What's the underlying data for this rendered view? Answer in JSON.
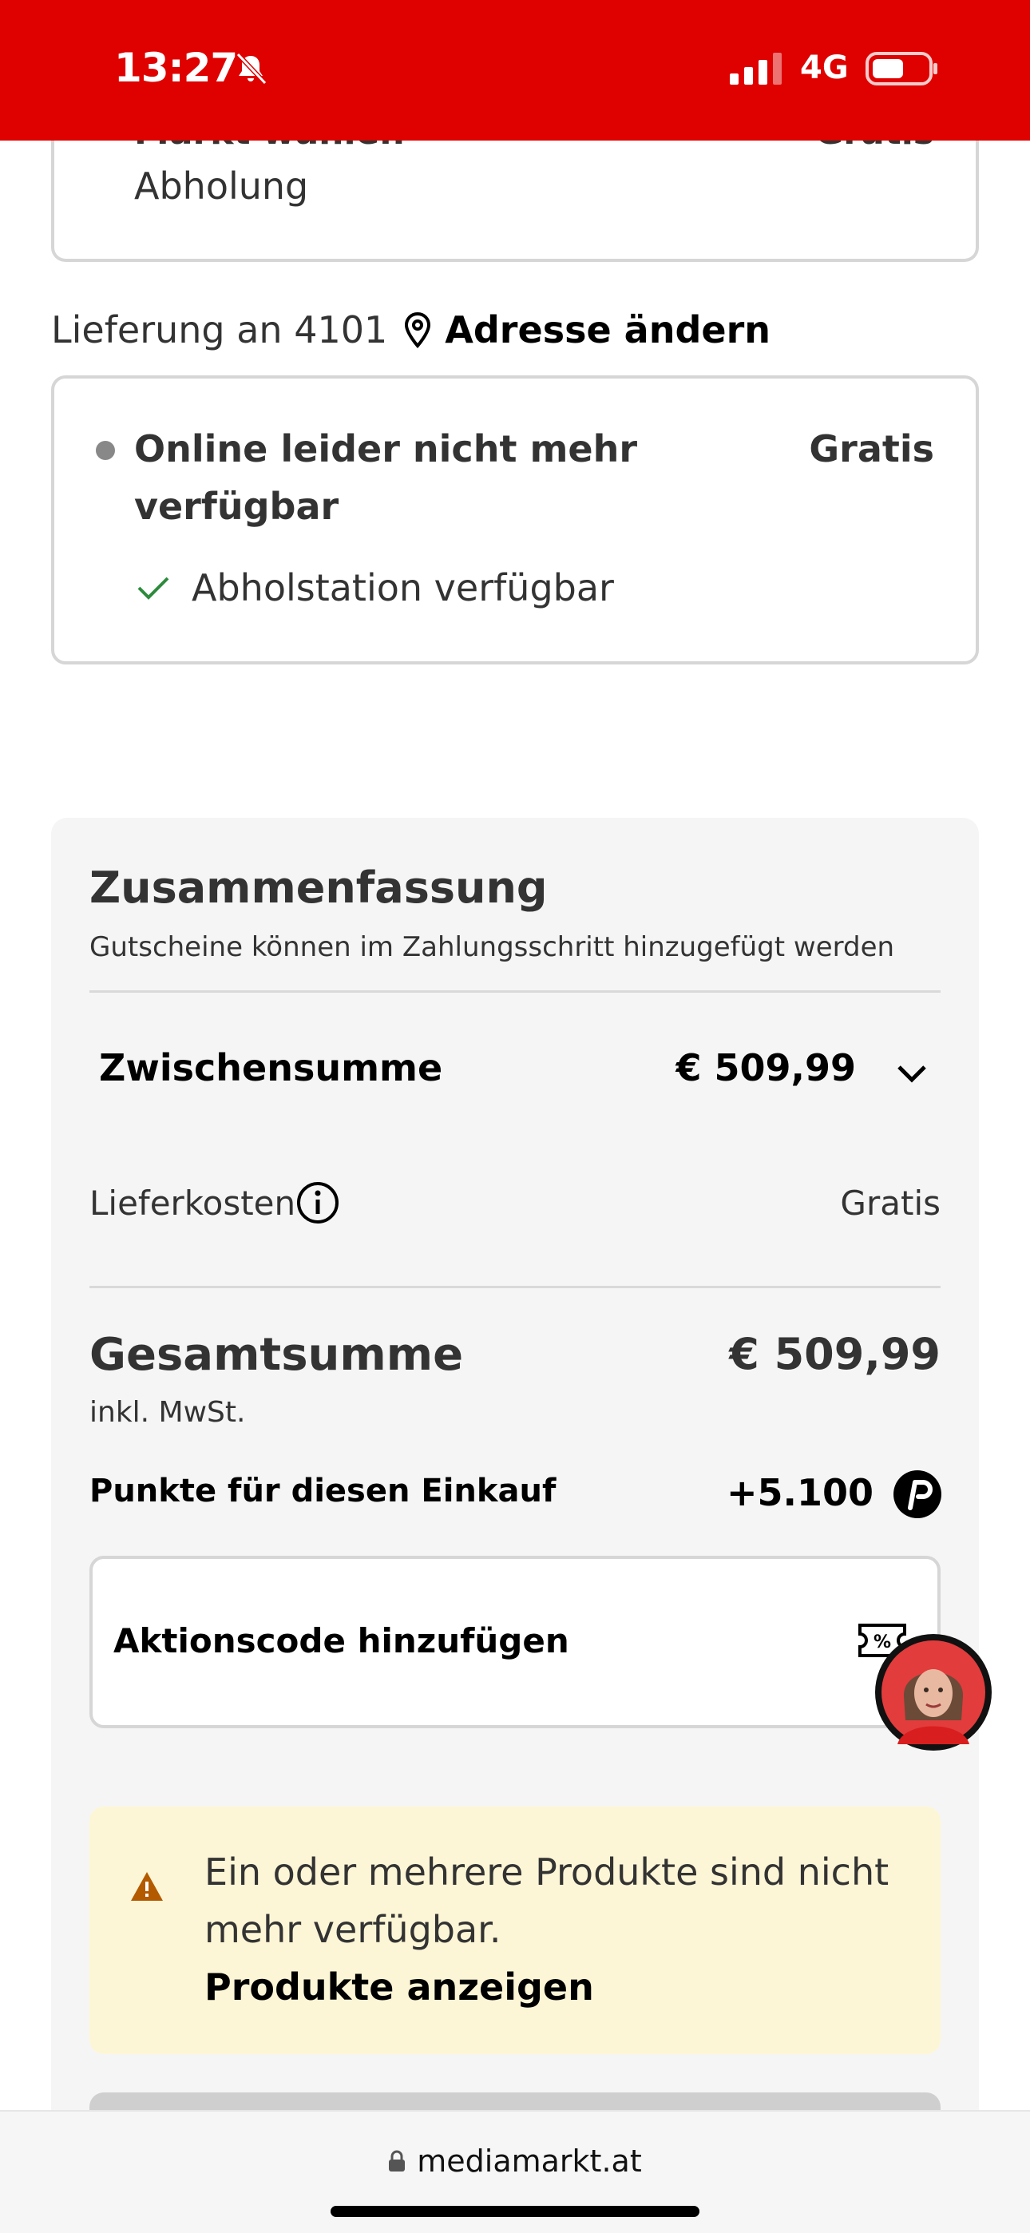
{
  "status_bar": {
    "time": "13:27",
    "network": "4G",
    "icons": [
      "bell-slash-icon",
      "signal-icon",
      "battery-icon"
    ],
    "background": "#df0000"
  },
  "top_card": {
    "title_cut": "Markt wählen",
    "price_cut": "Gratis",
    "subtitle": "Abholung"
  },
  "delivery": {
    "text": "Lieferung an 4101",
    "address_link": "Adresse ändern",
    "status": "Online leider nicht mehr verfügbar",
    "price": "Gratis",
    "pickup": "Abholstation verfügbar"
  },
  "summary": {
    "title": "Zusammenfassung",
    "note": "Gutscheine können im Zahlungsschritt hinzugefügt werden",
    "subtotal_label": "Zwischensumme",
    "subtotal_value": "€ 509,99",
    "shipping_label": "Lieferkosten",
    "shipping_value": "Gratis",
    "total_label": "Gesamtsumme",
    "total_value": "€ 509,99",
    "vat_note": "inkl. MwSt.",
    "points_label": "Punkte für diesen Einkauf",
    "points_value": "+5.100",
    "promo_label": "Aktionscode hinzufügen",
    "warning_text": "Ein oder mehrere Produkte sind nicht mehr verfügbar.",
    "warning_link": "Produkte anzeigen"
  },
  "browser": {
    "url": "mediamarkt.at"
  },
  "colors": {
    "brand_red": "#df0000",
    "panel_bg": "#f5f5f5",
    "warning_bg": "#fdf6d6",
    "warning_icon": "#b35900",
    "check_green": "#2e8b3d"
  }
}
